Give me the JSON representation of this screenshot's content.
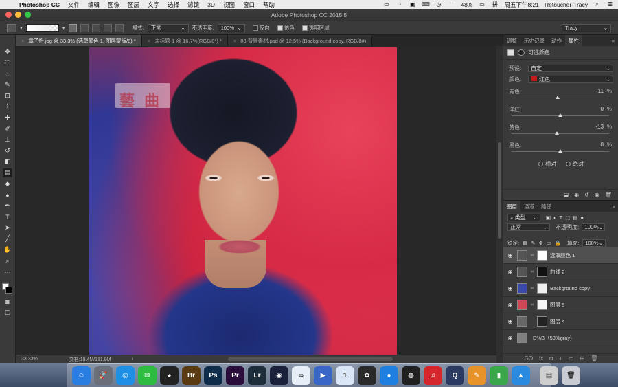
{
  "menubar": {
    "apple_glyph": "",
    "app_name": "Photoshop CC",
    "menus": [
      "文件",
      "编辑",
      "图像",
      "图层",
      "文字",
      "选择",
      "滤镜",
      "3D",
      "视图",
      "窗口",
      "帮助"
    ],
    "battery": "48%",
    "clock": "周五下午8:21",
    "user": "Retoucher-Tracy"
  },
  "window": {
    "title": "Adobe Photoshop CC 2015.5"
  },
  "options": {
    "mode_label": "模式:",
    "mode_value": "正常",
    "opacity_label": "不透明度:",
    "opacity_value": "100%",
    "reverse_label": "反向",
    "dither_label": "仿色",
    "transparency_label": "透明区域",
    "workspace": "Tracy"
  },
  "tabs": [
    {
      "label": "章子怡.jpg @ 33.3% (选取颜色 1, 图层蒙版/8) *",
      "close": "×"
    },
    {
      "label": "未标题-1 @ 16.7%(RGB/8*) *",
      "close": "×"
    },
    {
      "label": "03 背景素材.psd @ 12.5% (Background copy, RGB/8#)",
      "close": "×"
    }
  ],
  "status": {
    "zoom": "33.33%",
    "doc": "文档:18.4M/181.9M",
    "arrow": "›"
  },
  "panel_tabs": [
    "调整",
    "历史记录",
    "动作",
    "属性"
  ],
  "properties": {
    "title": "可选颜色",
    "preset_label": "预设:",
    "preset_value": "自定",
    "color_label": "颜色:",
    "color_value": "红色",
    "sliders": [
      {
        "label": "青色:",
        "value": "-11",
        "unit": "%",
        "fraction": 0.47
      },
      {
        "label": "洋红:",
        "value": "0",
        "unit": "%",
        "fraction": 0.5
      },
      {
        "label": "黄色:",
        "value": "-13",
        "unit": "%",
        "fraction": 0.465
      },
      {
        "label": "黑色:",
        "value": "0",
        "unit": "%",
        "fraction": 0.5
      }
    ],
    "relative_label": "相对",
    "absolute_label": "绝对"
  },
  "layers_tabs": [
    "图层",
    "通道",
    "路径"
  ],
  "layers": {
    "filter_label": "类型",
    "blend_mode": "正常",
    "opacity_label": "不透明度:",
    "opacity_value": "100%",
    "lock_label": "锁定:",
    "fill_label": "填充:",
    "fill_value": "100%",
    "items": [
      {
        "name": "选取颜色 1",
        "thumb_color": "#ffffff"
      },
      {
        "name": "曲线 2",
        "thumb_color": "#111111"
      },
      {
        "name": "Background copy",
        "thumb_color": "#3b4aa8"
      },
      {
        "name": "图层 5",
        "thumb_color": "#d04858"
      },
      {
        "name": "图层 4",
        "thumb_color": "#222222"
      },
      {
        "name": "D%B（50%gray)",
        "thumb_color": "#808080"
      }
    ],
    "footer": [
      "GO",
      "fx",
      "◘",
      "◐",
      "▭",
      "⊞",
      "🗑"
    ]
  },
  "dock_apps": [
    {
      "name": "Finder",
      "label": "☺",
      "color": "#2a7de1"
    },
    {
      "name": "Launchpad",
      "label": "🚀",
      "color": "#6a6f7a"
    },
    {
      "name": "Safari",
      "label": "◎",
      "color": "#1f8fe6"
    },
    {
      "name": "WeChat",
      "label": "✉",
      "color": "#2dbb40"
    },
    {
      "name": "QQ",
      "label": "◕",
      "color": "#222222"
    },
    {
      "name": "Bridge",
      "label": "Br",
      "color": "#5a3a10"
    },
    {
      "name": "Photoshop",
      "label": "Ps",
      "color": "#0d2d4a"
    },
    {
      "name": "Premiere",
      "label": "Pr",
      "color": "#2a0d3a"
    },
    {
      "name": "Lightroom",
      "label": "Lr",
      "color": "#1e2d3a"
    },
    {
      "name": "Cinema 4D",
      "label": "◉",
      "color": "#1a1f3a"
    },
    {
      "name": "Baidu Cloud",
      "label": "∞",
      "color": "#e8eef8"
    },
    {
      "name": "Video App",
      "label": "▶",
      "color": "#3a66c8"
    },
    {
      "name": "1Password",
      "label": "1",
      "color": "#d9e6f5"
    },
    {
      "name": "DaVinci",
      "label": "✿",
      "color": "#2a2a2a"
    },
    {
      "name": "Screen Recorder",
      "label": "●",
      "color": "#1e7fe0"
    },
    {
      "name": "OBS",
      "label": "◍",
      "color": "#202020"
    },
    {
      "name": "NetEase Music",
      "label": "♫",
      "color": "#d4262c"
    },
    {
      "name": "QuickTime",
      "label": "Q",
      "color": "#2a3a60"
    },
    {
      "name": "Pages",
      "label": "✎",
      "color": "#e8922a"
    },
    {
      "name": "Numbers",
      "label": "▮",
      "color": "#3aa84a"
    },
    {
      "name": "Keynote",
      "label": "▲",
      "color": "#2a8ae0"
    },
    {
      "name": "Scanner",
      "label": "▤",
      "color": "#cfcfcf"
    },
    {
      "name": "Trash",
      "label": "🗑",
      "color": "#c8ccd2"
    }
  ],
  "colors": {
    "foreground": "#ffffff",
    "background": "#000000",
    "selected_color": "#c21a1a"
  }
}
